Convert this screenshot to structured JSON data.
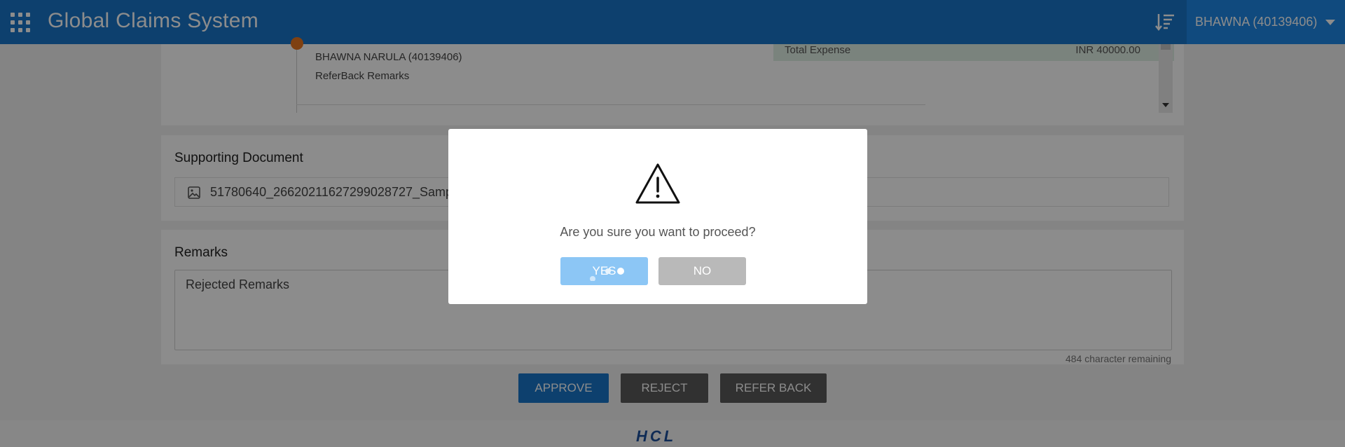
{
  "app": {
    "title": "Global Claims System",
    "user": "BHAWNA (40139406)"
  },
  "history": {
    "approver_name": "BHAWNA NARULA (40139406)",
    "remark": "ReferBack Remarks",
    "expense_label": "Total Expense",
    "expense_value": "INR 40000.00"
  },
  "documents": {
    "title": "Supporting Document",
    "file_name": "51780640_26620211627299028727_Samp"
  },
  "remarks": {
    "title": "Remarks",
    "value": "Rejected Remarks",
    "chars_remaining": "484 character remaining"
  },
  "actions": {
    "approve": "APPROVE",
    "reject": "REJECT",
    "refer_back": "REFER BACK"
  },
  "footer": {
    "logo": "HCL"
  },
  "dialog": {
    "message": "Are you sure you want to proceed?",
    "yes": "YES",
    "no": "NO"
  },
  "colors": {
    "primary": "#1976c9",
    "secondary": "#5a5a5a",
    "timeline_dot": "#e87722",
    "yes_button": "#8cc6f5",
    "no_button": "#b9b9b9"
  }
}
